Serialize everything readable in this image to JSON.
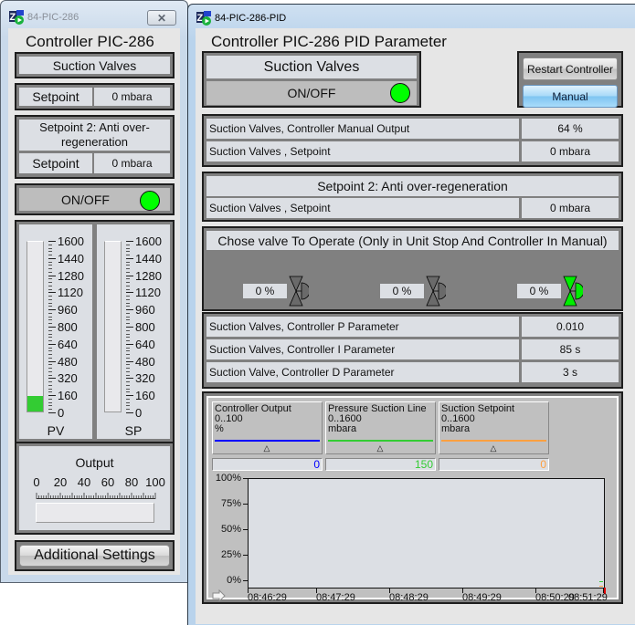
{
  "window_left": {
    "title": "84-PIC-286",
    "heading": "Controller PIC-286",
    "group_title": "Suction Valves",
    "setpoint_label": "Setpoint",
    "setpoint_value": "0 mbara",
    "setpoint2_title": "Setpoint 2: Anti over-regeneration",
    "setpoint2_label": "Setpoint",
    "setpoint2_value": "0 mbara",
    "onoff_label": "ON/OFF",
    "onoff_state": "on",
    "gauges": [
      {
        "name": "PV",
        "value": 150,
        "max": 1600,
        "ticks": [
          "1600",
          "1440",
          "1280",
          "1120",
          "960",
          "800",
          "640",
          "480",
          "320",
          "160",
          "0"
        ]
      },
      {
        "name": "SP",
        "value": 0,
        "max": 1600,
        "ticks": [
          "1600",
          "1440",
          "1280",
          "1120",
          "960",
          "800",
          "640",
          "480",
          "320",
          "160",
          "0"
        ]
      }
    ],
    "output": {
      "label": "Output",
      "ticks": [
        "0",
        "20",
        "40",
        "60",
        "80",
        "100"
      ],
      "value_text": ""
    },
    "additional_settings_label": "Additional Settings"
  },
  "window_right": {
    "title": "84-PIC-286-PID",
    "heading": "Controller PIC-286 PID Parameter",
    "group_title": "Suction Valves",
    "onoff_label": "ON/OFF",
    "onoff_state": "on",
    "restart_button": "Restart Controller",
    "manual_button": "Manual",
    "params_1": [
      {
        "label": "Suction Valves, Controller Manual Output",
        "value": "64 %"
      },
      {
        "label": "Suction Valves , Setpoint",
        "value": "0 mbara"
      }
    ],
    "setpoint2": {
      "title": "Setpoint 2: Anti over-regeneration",
      "label": "Suction Valves , Setpoint",
      "value": "0 mbara"
    },
    "valve_section": {
      "title": "Chose valve To Operate (Only in Unit Stop And Controller In Manual)",
      "valves": [
        {
          "value": "0 %",
          "state": "inactive"
        },
        {
          "value": "0 %",
          "state": "inactive"
        },
        {
          "value": "0 %",
          "state": "active"
        }
      ]
    },
    "pid_params": [
      {
        "label": "Suction Valves, Controller P Parameter",
        "value": "0.010"
      },
      {
        "label": "Suction Valves, Controller I Parameter",
        "value": "85 s"
      },
      {
        "label": "Suction Valve, Controller D Parameter",
        "value": "3 s"
      }
    ],
    "trend": {
      "pens": [
        {
          "name": "Controller Output",
          "range": "0..100",
          "unit": "%",
          "value": "0",
          "color": "#0000ff"
        },
        {
          "name": "Pressure Suction Line",
          "range": "0..1600",
          "unit": "mbara",
          "value": "150",
          "color": "#33cc33"
        },
        {
          "name": "Suction Setpoint",
          "range": "0..1600",
          "unit": "mbara",
          "value": "0",
          "color": "#ffa040"
        }
      ],
      "y_labels": [
        "100%",
        "75%",
        "50%",
        "25%",
        "0%"
      ],
      "x_labels": [
        "08:46:29",
        "08:47:29",
        "08:48:29",
        "08:49:29",
        "08:50:29",
        "08:51:29"
      ]
    }
  },
  "colors": {
    "led_on": "#00ff00",
    "valve_active": "#00ee00",
    "valve_inactive": "#6a6a6a",
    "pv_fill": "#33cc33"
  }
}
